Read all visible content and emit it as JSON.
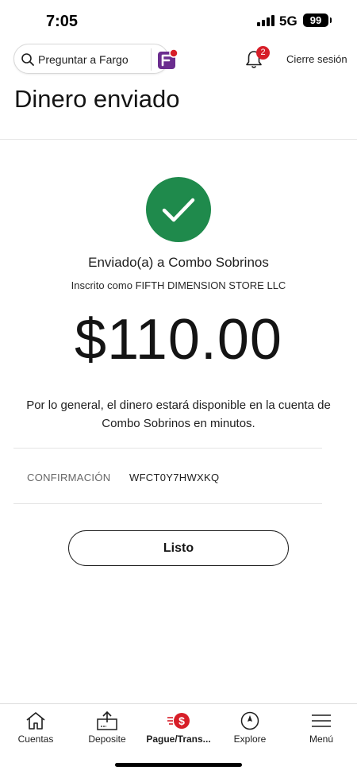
{
  "status_bar": {
    "time": "7:05",
    "network": "5G",
    "battery": "99"
  },
  "header": {
    "search_placeholder": "Preguntar a Fargo",
    "notification_count": "2",
    "signout_label": "Cierre sesión",
    "icons": [
      "search-icon",
      "fargo-icon",
      "bell-icon"
    ]
  },
  "page": {
    "title": "Dinero enviado"
  },
  "confirmation": {
    "sent_to": "Enviado(a) a Combo Sobrinos",
    "registered_as": "Inscrito como FIFTH DIMENSION STORE LLC",
    "amount": "$110.00",
    "availability_note": "Por lo general, el dinero estará disponible en la cuenta de Combo Sobrinos en minutos.",
    "code_label": "CONFIRMACIÓN",
    "code_value": "WFCT0Y7HWXKQ",
    "done_label": "Listo"
  },
  "nav": {
    "items": [
      {
        "label": "Cuentas",
        "icon": "home-icon",
        "active": false
      },
      {
        "label": "Deposite",
        "icon": "deposit-icon",
        "active": false
      },
      {
        "label": "Pague/Trans...",
        "icon": "pay-transfer-icon",
        "active": true
      },
      {
        "label": "Explore",
        "icon": "compass-icon",
        "active": false
      },
      {
        "label": "Menú",
        "icon": "menu-icon",
        "active": false
      }
    ]
  },
  "colors": {
    "success": "#1f8a4c",
    "brand_red": "#d71e28",
    "fargo_purple": "#6b2d8f"
  }
}
